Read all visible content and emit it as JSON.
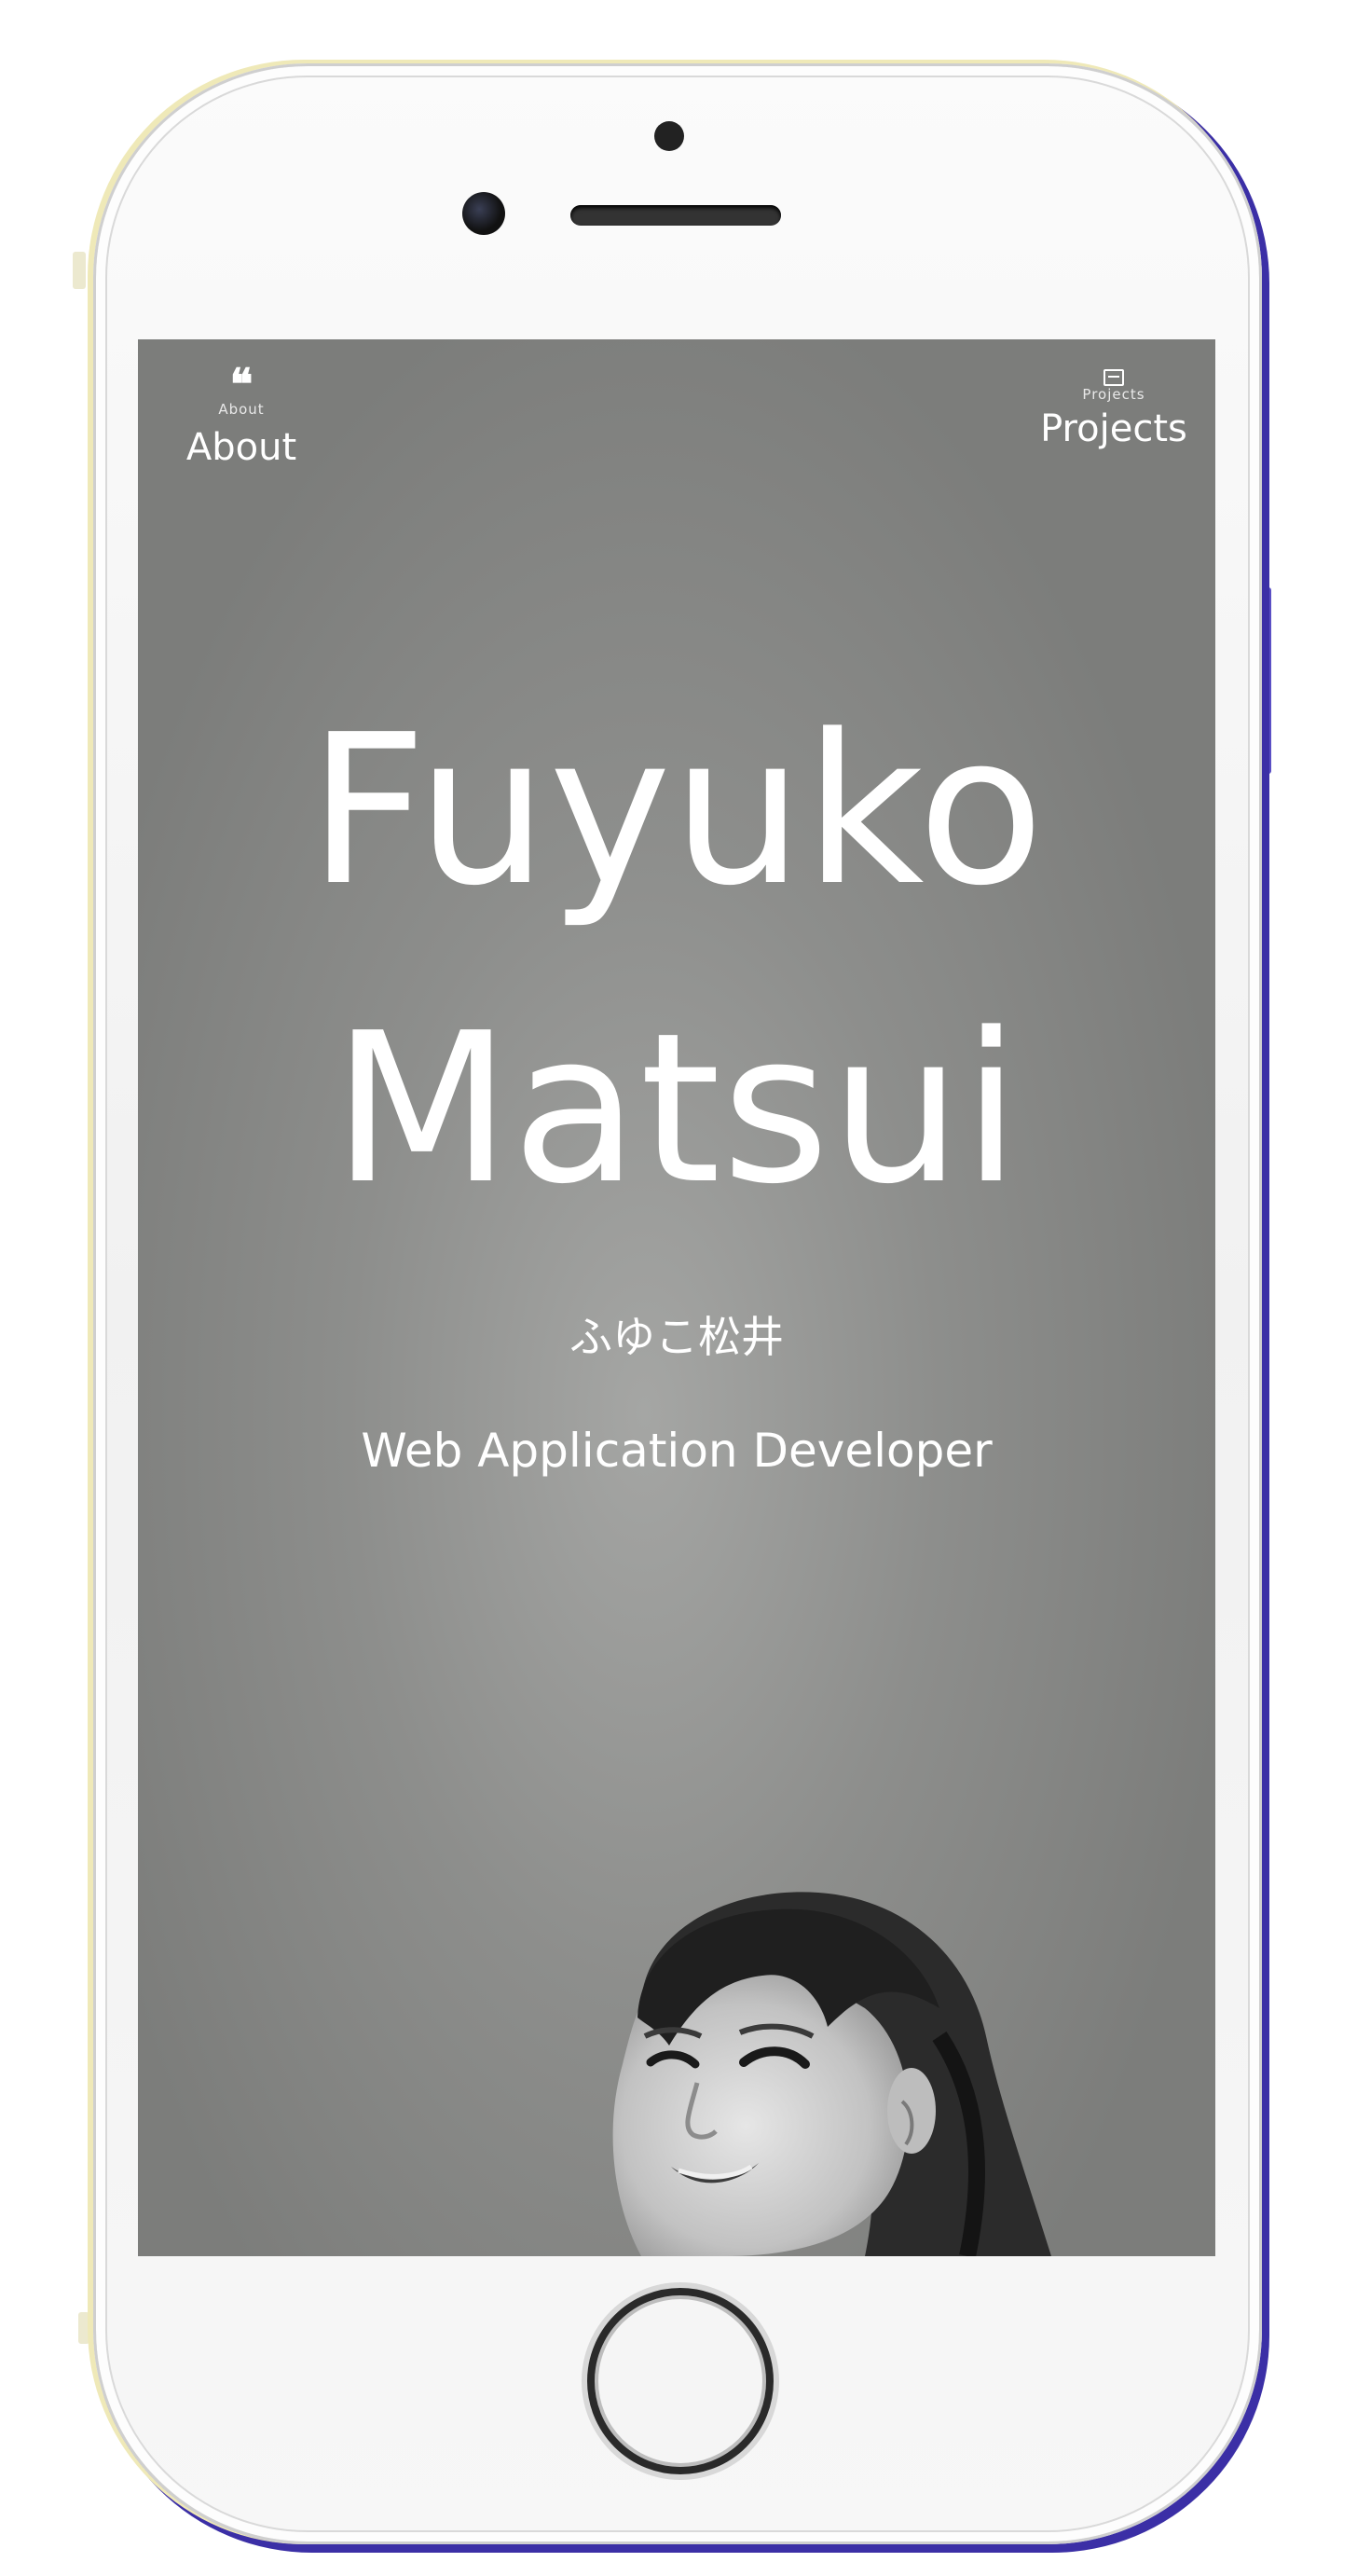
{
  "nav": {
    "about": {
      "icon": "quote-icon",
      "icon_caption": "About",
      "label": "About"
    },
    "projects": {
      "icon": "projects-icon",
      "icon_caption": "Projects",
      "label": "Projects"
    }
  },
  "hero": {
    "first_name": "Fuyuko",
    "last_name": "Matsui",
    "japanese_name": "ふゆこ松井",
    "role": "Web Application Developer"
  },
  "theme": {
    "background": "#8d8e8c",
    "text": "#ffffff"
  }
}
